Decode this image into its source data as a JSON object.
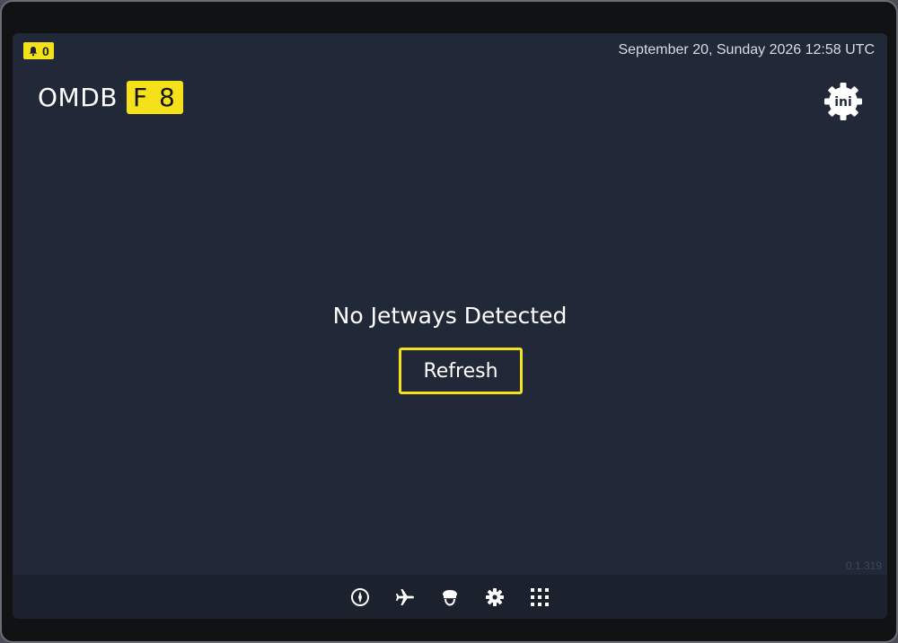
{
  "status": {
    "notification_count": "0",
    "datetime": "September 20, Sunday 2026 12:58 UTC"
  },
  "header": {
    "airport": "OMDB",
    "gate": "F 8",
    "ini_label": "ini"
  },
  "main": {
    "message": "No Jetways Detected",
    "refresh_label": "Refresh"
  },
  "footer": {
    "version": "0.1.319",
    "nav": [
      {
        "name": "compass-icon"
      },
      {
        "name": "airplane-icon"
      },
      {
        "name": "pilot-cap-icon"
      },
      {
        "name": "gear-icon"
      },
      {
        "name": "grid-icon"
      }
    ]
  },
  "colors": {
    "accent": "#f4e11a",
    "background": "#212837",
    "bottom_bar": "#1b212d"
  }
}
